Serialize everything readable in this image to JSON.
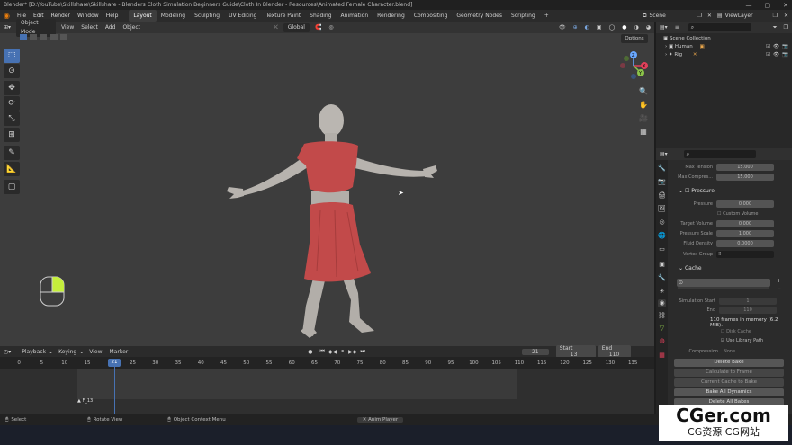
{
  "window": {
    "title": "Blender* [D:\\YouTube\\Skillshare\\Skillshare - Blenders Cloth Simulation Beginners Guide\\Cloth In Blender - Resources\\Animated Female Character.blend]"
  },
  "menu": [
    "File",
    "Edit",
    "Render",
    "Window",
    "Help"
  ],
  "workspaces": [
    "Layout",
    "Modeling",
    "Sculpting",
    "UV Editing",
    "Texture Paint",
    "Shading",
    "Animation",
    "Rendering",
    "Compositing",
    "Geometry Nodes",
    "Scripting"
  ],
  "scene": {
    "label": "Scene",
    "view_layer": "ViewLayer"
  },
  "viewport": {
    "mode": "Object Mode",
    "menus": [
      "View",
      "Select",
      "Add",
      "Object"
    ],
    "orientation": "Global",
    "options": "Options",
    "axes": {
      "x": "X",
      "y": "Y",
      "z": "Z"
    }
  },
  "outliner": {
    "collection": "Scene Collection",
    "items": [
      {
        "name": "Human"
      },
      {
        "name": "Rig"
      }
    ]
  },
  "properties": {
    "fields": [
      {
        "label": "Max Tension",
        "value": "15.000"
      },
      {
        "label": "Max Compres...",
        "value": "15.000"
      }
    ],
    "pressure": {
      "title": "Pressure",
      "pressure": {
        "label": "Pressure",
        "value": "0.000"
      },
      "custom_volume": "Custom Volume",
      "target_volume": {
        "label": "Target Volume",
        "value": "0.000"
      },
      "pressure_scale": {
        "label": "Pressure Scale",
        "value": "1.000"
      },
      "fluid_density": {
        "label": "Fluid Density",
        "value": "0.0000"
      },
      "vertex_group": {
        "label": "Vertex Group"
      }
    },
    "cache": {
      "title": "Cache",
      "sim_start": {
        "label": "Simulation Start",
        "value": "1"
      },
      "end": {
        "label": "End",
        "value": "110"
      },
      "info": "110 frames in memory (6.2 MiB).",
      "disk_cache": "Disk Cache",
      "use_library_path": "Use Library Path",
      "compression": {
        "label": "Compression",
        "value": "None"
      }
    },
    "buttons": [
      "Delete Bake",
      "Calculate to Frame",
      "Current Cache to Bake",
      "Bake All Dynamics",
      "Delete All Bakes"
    ]
  },
  "timeline": {
    "menus": [
      "Playback",
      "Keying",
      "View",
      "Marker"
    ],
    "current_frame": "21",
    "start_label": "Start",
    "start": "13",
    "end_label": "End",
    "end": "110",
    "ticks": [
      "0",
      "5",
      "10",
      "15",
      "21",
      "25",
      "30",
      "35",
      "40",
      "45",
      "50",
      "55",
      "60",
      "65",
      "70",
      "75",
      "80",
      "85",
      "90",
      "95",
      "100",
      "105",
      "110",
      "115",
      "120",
      "125",
      "130",
      "135"
    ],
    "marker": "F_13"
  },
  "status": {
    "select": "Select",
    "rotate": "Rotate View",
    "context": "Object Context Menu",
    "anim": "Anim Player"
  },
  "watermark": {
    "main": "CGer.com",
    "sub": "CG资源 CG网站"
  },
  "colors": {
    "accent": "#4772b3",
    "cloth": "#c24a4a",
    "skin": "#b7b3ae",
    "frame": "#4772b3"
  }
}
